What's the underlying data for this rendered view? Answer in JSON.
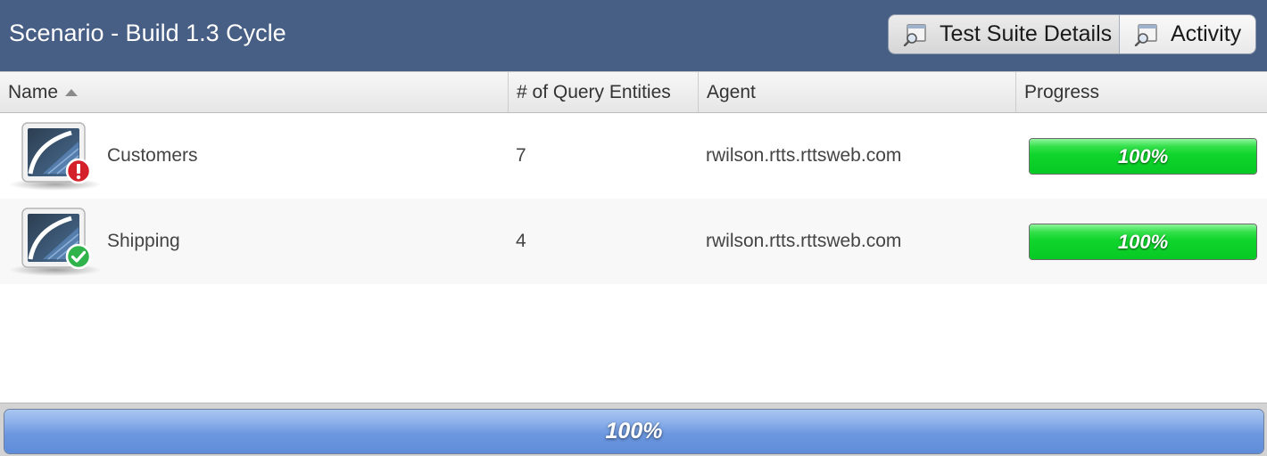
{
  "header": {
    "title": "Scenario - Build 1.3 Cycle",
    "buttons": [
      {
        "label": "Test Suite Details",
        "icon": "magnifier-icon",
        "active": true
      },
      {
        "label": "Activity",
        "icon": "magnifier-icon",
        "active": false
      }
    ]
  },
  "table": {
    "columns": [
      {
        "label": "Name",
        "sorted": "ascending"
      },
      {
        "label": "# of Query Entities"
      },
      {
        "label": "Agent"
      },
      {
        "label": "Progress"
      }
    ],
    "rows": [
      {
        "name": "Customers",
        "query_entities": "7",
        "agent": "rwilson.rtts.rttsweb.com",
        "progress": 1.0,
        "progress_label": "100%",
        "status": "error",
        "status_icon": "error-badge-icon"
      },
      {
        "name": "Shipping",
        "query_entities": "4",
        "agent": "rwilson.rtts.rttsweb.com",
        "progress": 1.0,
        "progress_label": "100%",
        "status": "success",
        "status_icon": "success-check-icon"
      }
    ]
  },
  "overall": {
    "progress": 1.0,
    "progress_label": "100%"
  },
  "colors": {
    "header_bg": "#485f85",
    "row_progress_green": "#10d52c",
    "overall_progress_blue": "#6d98e0",
    "error_red": "#d4202a",
    "success_green": "#2fb34a"
  }
}
